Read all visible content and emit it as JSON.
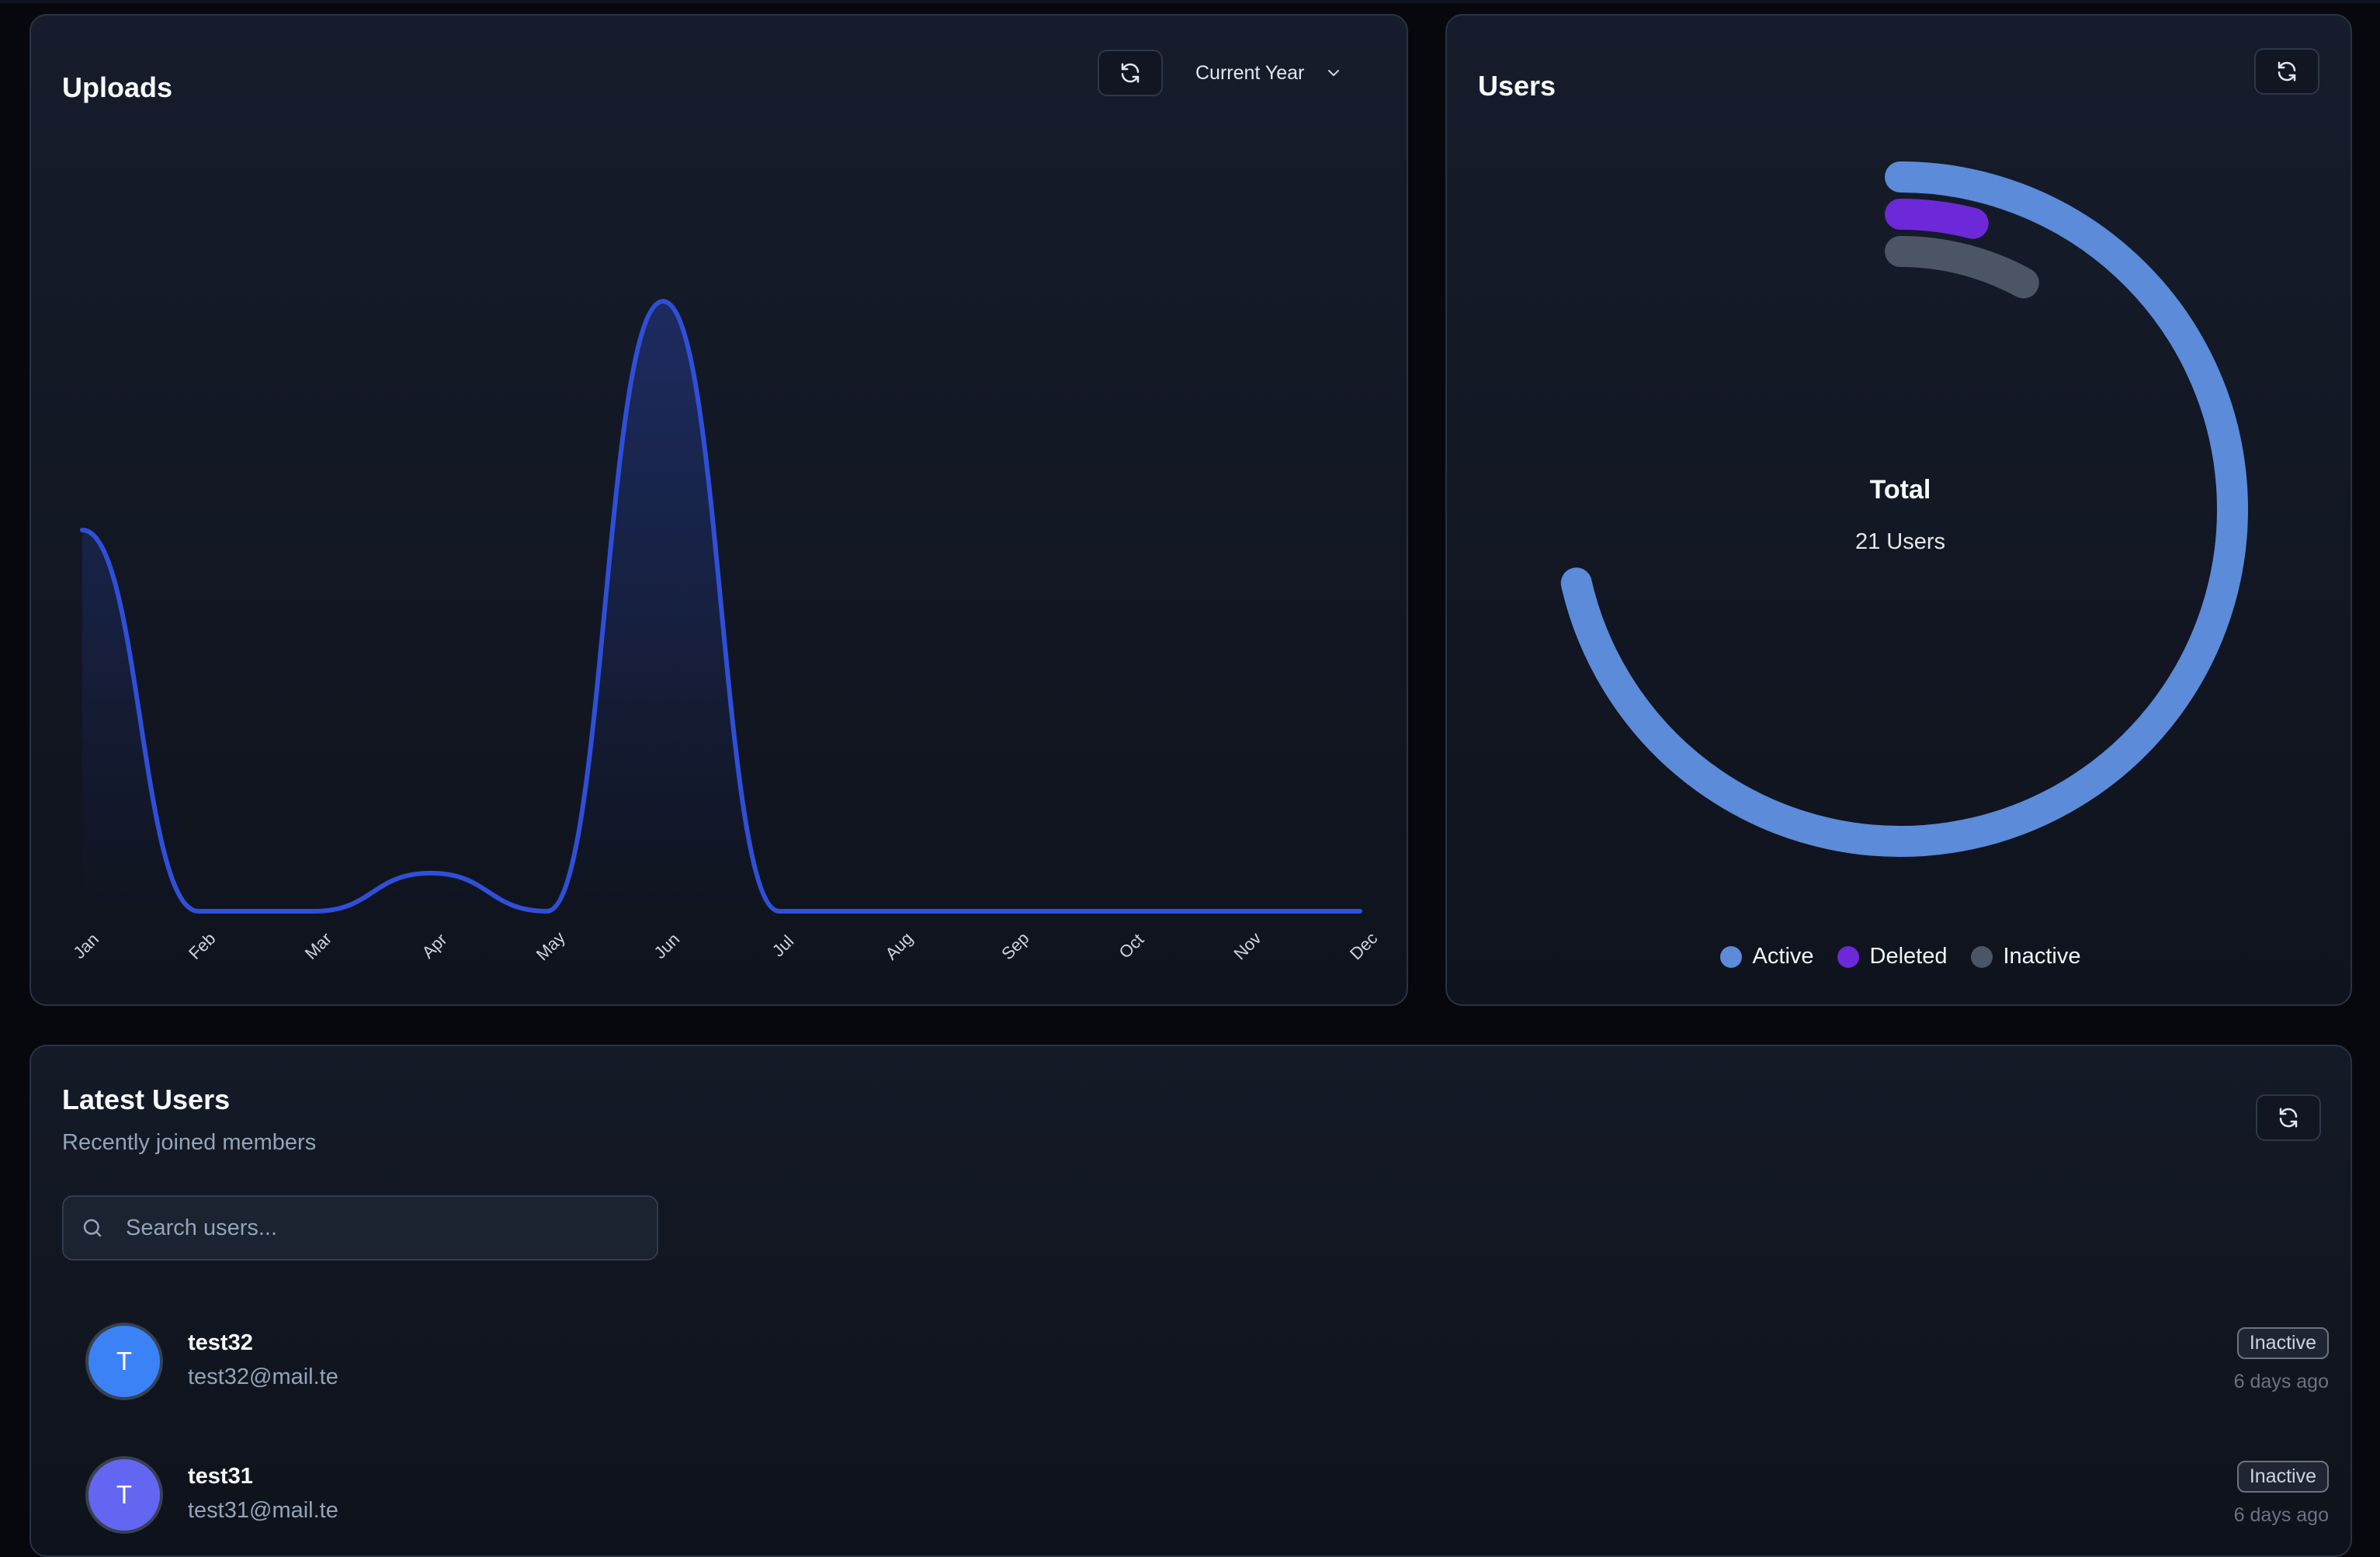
{
  "uploads": {
    "title": "Uploads",
    "period_select": {
      "label": "Current Year"
    },
    "refresh_icon": "refresh-icon",
    "chart_data": {
      "type": "area",
      "categories": [
        "Jan",
        "Feb",
        "Mar",
        "Apr",
        "May",
        "Jun",
        "Jul",
        "Aug",
        "Sep",
        "Oct",
        "Nov",
        "Dec"
      ],
      "series": [
        {
          "values": [
            5,
            0,
            0,
            0.5,
            0,
            8,
            0,
            0,
            0,
            0,
            0,
            0
          ]
        }
      ],
      "ylim": [
        0,
        9
      ],
      "line_color": "#2f4fd8",
      "grid": false,
      "y_axis_visible": false
    }
  },
  "users": {
    "title": "Users",
    "center_title": "Total",
    "center_count": "21 Users",
    "legend": [
      {
        "label": "Active",
        "color": "#5b8bd9"
      },
      {
        "label": "Deleted",
        "color": "#6d28d9"
      },
      {
        "label": "Inactive",
        "color": "#4b5563"
      }
    ],
    "chart_data": {
      "type": "radial-bar",
      "categories": [
        "Active",
        "Deleted",
        "Inactive"
      ],
      "values": [
        18,
        1,
        2
      ],
      "total": 21
    }
  },
  "latest": {
    "title": "Latest Users",
    "subtitle": "Recently joined members",
    "search": {
      "placeholder": "Search users...",
      "value": ""
    },
    "users": [
      {
        "initial": "T",
        "name": "test32",
        "email": "test32@mail.te",
        "status": "Inactive",
        "joined": "6 days ago",
        "avatar_color": "#3b82f6"
      },
      {
        "initial": "T",
        "name": "test31",
        "email": "test31@mail.te",
        "status": "Inactive",
        "joined": "6 days ago",
        "avatar_color": "#6366f1"
      }
    ]
  }
}
